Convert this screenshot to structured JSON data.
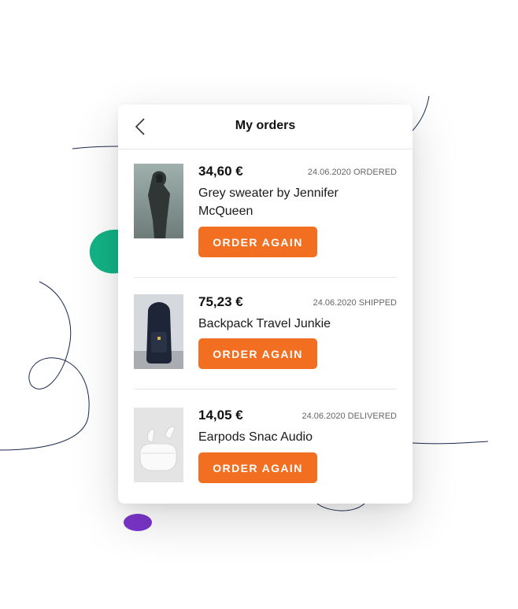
{
  "header": {
    "title": "My orders",
    "back_icon": "chevron-left-icon"
  },
  "orders": [
    {
      "price": "34,60 €",
      "date": "24.06.2020",
      "status": "ORDERED",
      "name": "Grey sweater by Jennifer McQueen",
      "button": "ORDER AGAIN"
    },
    {
      "price": "75,23 €",
      "date": "24.06.2020",
      "status": "SHIPPED",
      "name": "Backpack Travel Junkie",
      "button": "ORDER AGAIN"
    },
    {
      "price": "14,05 €",
      "date": "24.06.2020",
      "status": "DELIVERED",
      "name": "Earpods Snac Audio",
      "button": "ORDER AGAIN"
    }
  ],
  "colors": {
    "accent": "#f26f21",
    "green_blob": "#14b386",
    "purple_blob": "#7b35c9",
    "line": "#1d2a4f"
  }
}
